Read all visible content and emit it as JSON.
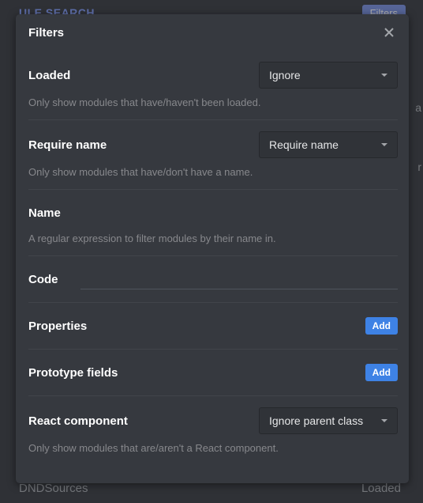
{
  "background": {
    "header": "ULE SEARCH",
    "filters_btn": "Filters",
    "side_a": "a",
    "side_r": "r",
    "bottom_left": "DNDSources",
    "bottom_right": "Loaded"
  },
  "modal": {
    "title": "Filters"
  },
  "filters": {
    "loaded": {
      "label": "Loaded",
      "selected": "Ignore",
      "desc": "Only show modules that have/haven't been loaded."
    },
    "require_name": {
      "label": "Require name",
      "selected": "Require name",
      "desc": "Only show modules that have/don't have a name."
    },
    "name": {
      "label": "Name",
      "desc": "A regular expression to filter modules by their name in."
    },
    "code": {
      "label": "Code"
    },
    "properties": {
      "label": "Properties",
      "add": "Add"
    },
    "prototype_fields": {
      "label": "Prototype fields",
      "add": "Add"
    },
    "react_component": {
      "label": "React component",
      "selected": "Ignore parent class",
      "desc": "Only show modules that are/aren't a React component."
    }
  }
}
